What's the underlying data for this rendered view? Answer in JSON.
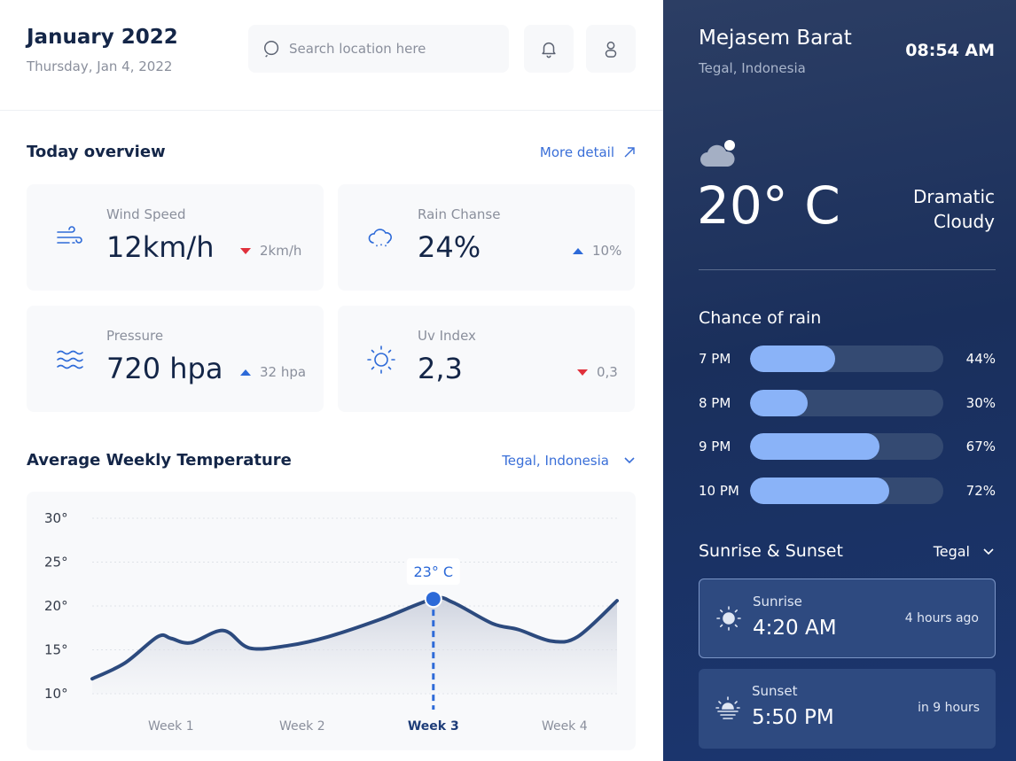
{
  "header": {
    "title": "January 2022",
    "date": "Thursday, Jan 4, 2022",
    "search_placeholder": "Search location here",
    "icons": [
      "search-icon",
      "bell-icon",
      "user-icon"
    ]
  },
  "overview": {
    "title": "Today overview",
    "more_label": "More detail",
    "cards": [
      {
        "label": "Wind Speed",
        "value": "12km/h",
        "delta": "2km/h",
        "trend": "down",
        "icon": "wind-icon"
      },
      {
        "label": "Rain Chanse",
        "value": "24%",
        "delta": "10%",
        "trend": "up",
        "icon": "rain-cloud-icon"
      },
      {
        "label": "Pressure",
        "value": "720 hpa",
        "delta": "32 hpa",
        "trend": "up",
        "icon": "waves-icon"
      },
      {
        "label": "Uv Index",
        "value": "2,3",
        "delta": "0,3",
        "trend": "down",
        "icon": "sun-icon"
      }
    ]
  },
  "weekly": {
    "title": "Average Weekly Temperature",
    "location": "Tegal, Indonesia"
  },
  "chart_data": {
    "type": "area",
    "title": "",
    "xlabel": "",
    "ylabel": "",
    "x_ticks": [
      "Week 1",
      "Week 2",
      "Week 3",
      "Week 4"
    ],
    "y_ticks": [
      "30°",
      "25°",
      "20°",
      "15°",
      "10°"
    ],
    "ylim": [
      10,
      30
    ],
    "xlim": [
      0.4,
      4.4
    ],
    "x": [
      0.4,
      0.65,
      0.9,
      1.0,
      1.15,
      1.4,
      1.6,
      1.9,
      2.2,
      2.6,
      3.0,
      3.15,
      3.45,
      3.65,
      3.9,
      4.1,
      4.4
    ],
    "y": [
      11.7,
      13.5,
      16.5,
      16.3,
      15.8,
      17.2,
      15.2,
      15.5,
      16.5,
      18.5,
      20.8,
      20.4,
      18,
      17.3,
      16,
      16.5,
      20.6
    ],
    "highlight": {
      "x": 3.0,
      "y": 20.8,
      "label": "23° C",
      "tick": "Week 3"
    },
    "grid": true,
    "colors": {
      "line": "#2c4a7e",
      "highlight": "#2d6ad8"
    }
  },
  "side": {
    "location": "Mejasem Barat",
    "region": "Tegal, Indonesia",
    "time": "08:54 AM",
    "temperature": "20° C",
    "condition_line1": "Dramatic",
    "condition_line2": "Cloudy",
    "rain_title": "Chance of rain",
    "rain": [
      {
        "time": "7 PM",
        "pct": "44%",
        "value": 0.44
      },
      {
        "time": "8 PM",
        "pct": "30%",
        "value": 0.3
      },
      {
        "time": "9 PM",
        "pct": "67%",
        "value": 0.67
      },
      {
        "time": "10 PM",
        "pct": "72%",
        "value": 0.72
      }
    ],
    "sun_title": "Sunrise & Sunset",
    "sun_location": "Tegal",
    "sunrise": {
      "label": "Sunrise",
      "time": "4:20 AM",
      "relative": "4 hours ago"
    },
    "sunset": {
      "label": "Sunset",
      "time": "5:50 PM",
      "relative": "in 9 hours"
    }
  },
  "colors": {
    "accent": "#3a6fd8",
    "navy": "#142648",
    "panel": "#1a2f5c",
    "bar_fill": "#8ab3f8",
    "down": "#e0303b",
    "up": "#2d6ad8"
  }
}
